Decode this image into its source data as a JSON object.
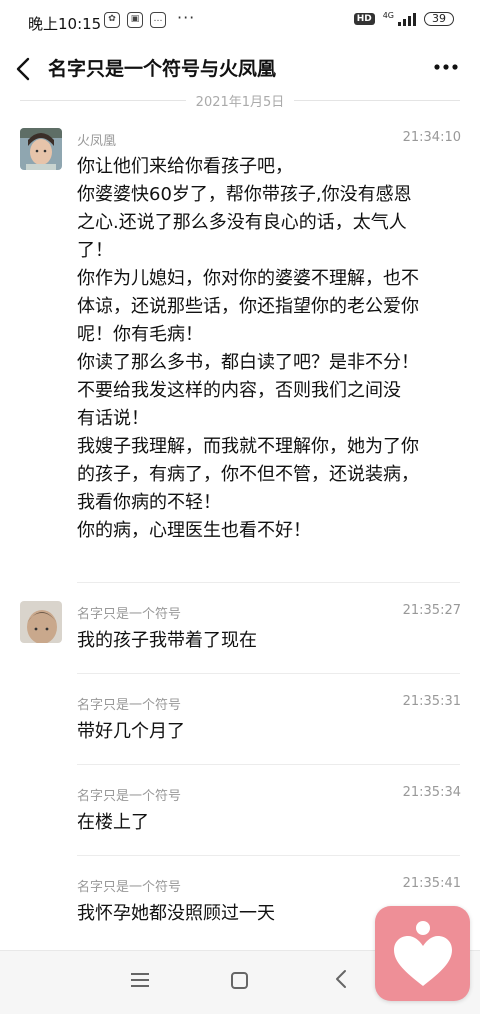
{
  "status_bar": {
    "time": "晚上10:15",
    "hd": "HD",
    "network": "4G",
    "battery": "39"
  },
  "header": {
    "title": "名字只是一个符号与火凤凰"
  },
  "date_separator": "2021年1月5日",
  "messages": [
    {
      "sender": "火凤凰",
      "time": "21:34:10",
      "lines": [
        "你让他们来给你看孩子吧，",
        "你婆婆快60岁了，帮你带孩子,你没有感恩",
        "之心.还说了那么多没有良心的话，太气人",
        "了！",
        "你作为儿媳妇，你对你的婆婆不理解，也不",
        "体谅，还说那些话，你还指望你的老公爱你",
        "呢！你有毛病！",
        "你读了那么多书，都白读了吧？是非不分！",
        "不要给我发这样的内容，否则我们之间没",
        "有话说！",
        "我嫂子我理解，而我就不理解你，她为了你",
        "的孩子，有病了，你不但不管，还说装病，",
        "我看你病的不轻！",
        "你的病，心理医生也看不好！"
      ]
    },
    {
      "sender": "名字只是一个符号",
      "time": "21:35:27",
      "text": "我的孩子我带着了现在"
    },
    {
      "sender": "名字只是一个符号",
      "time": "21:35:31",
      "text": "带好几个月了"
    },
    {
      "sender": "名字只是一个符号",
      "time": "21:35:34",
      "text": "在楼上了"
    },
    {
      "sender": "名字只是一个符号",
      "time": "21:35:41",
      "text": "我怀孕她都没照顾过一天"
    }
  ],
  "icons": {
    "back": "chevron-left-icon",
    "more": "more-dots-icon",
    "nav_menu": "menu-icon",
    "nav_home": "home-square-icon",
    "nav_back": "nav-back-icon",
    "float": "heart-person-icon"
  },
  "colors": {
    "float_button": "#ee8f97",
    "meta_text": "#999999"
  }
}
